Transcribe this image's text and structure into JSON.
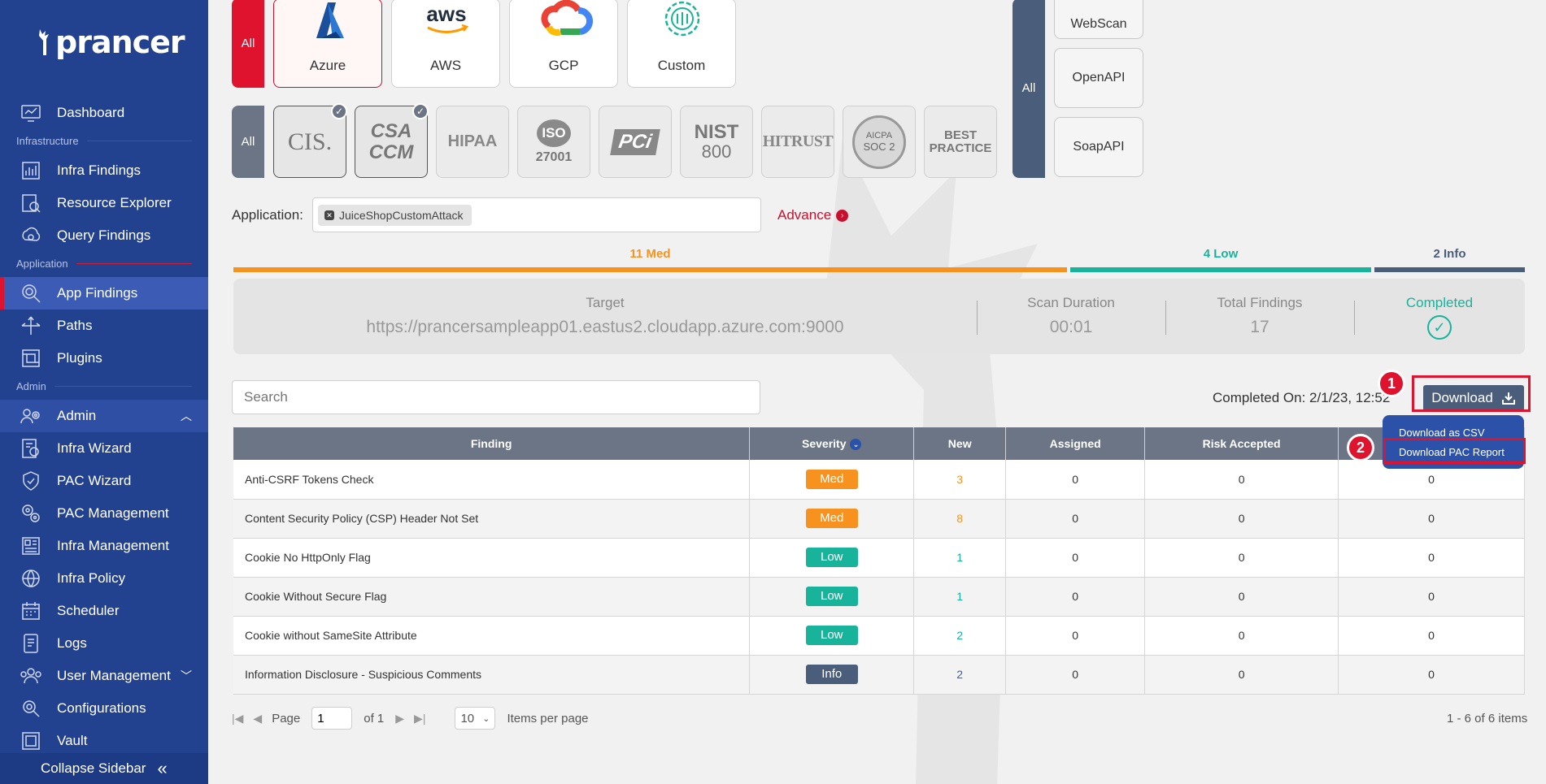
{
  "brand": {
    "name": "prancer"
  },
  "sidebar": {
    "sections": {
      "infrastructure": "Infrastructure",
      "application": "Application",
      "admin": "Admin"
    },
    "items": [
      {
        "label": "Dashboard",
        "icon": "dashboard-icon"
      },
      {
        "label": "Infra Findings",
        "icon": "infra-findings-icon"
      },
      {
        "label": "Resource Explorer",
        "icon": "resource-explorer-icon"
      },
      {
        "label": "Query Findings",
        "icon": "query-findings-icon"
      },
      {
        "label": "App Findings",
        "icon": "app-findings-icon",
        "active": true
      },
      {
        "label": "Paths",
        "icon": "paths-icon"
      },
      {
        "label": "Plugins",
        "icon": "plugins-icon"
      },
      {
        "label": "Admin",
        "icon": "admin-icon",
        "expanded": true
      },
      {
        "label": "Infra Wizard",
        "icon": "infra-wizard-icon"
      },
      {
        "label": "PAC Wizard",
        "icon": "pac-wizard-icon"
      },
      {
        "label": "PAC Management",
        "icon": "pac-management-icon"
      },
      {
        "label": "Infra Management",
        "icon": "infra-management-icon"
      },
      {
        "label": "Infra Policy",
        "icon": "infra-policy-icon"
      },
      {
        "label": "Scheduler",
        "icon": "scheduler-icon"
      },
      {
        "label": "Logs",
        "icon": "logs-icon"
      },
      {
        "label": "User Management",
        "icon": "user-management-icon"
      },
      {
        "label": "Configurations",
        "icon": "configurations-icon"
      },
      {
        "label": "Vault",
        "icon": "vault-icon"
      }
    ],
    "collapse_label": "Collapse Sidebar"
  },
  "filters": {
    "all_label": "All",
    "clouds": [
      "Azure",
      "AWS",
      "GCP",
      "Custom"
    ],
    "aws_logo_text": "aws",
    "compliance": [
      "CIS",
      "CSA CCM",
      "HIPAA",
      "ISO 27001",
      "PCI",
      "NIST 800",
      "HITRUST",
      "AICPA SOC 2",
      "BEST PRACTICE"
    ],
    "compliance_logo_text": {
      "cis": "CIS.",
      "csa": "CSA",
      "ccm": "CCM",
      "hipaa": "HIPAA",
      "iso": "ISO",
      "iso_num": "27001",
      "pci": "PCi",
      "nist": "NIST",
      "nist_num": "800",
      "hitrust": "HITRUST",
      "soc1": "AICPA",
      "soc2": "SOC 2",
      "bp1": "BEST",
      "bp2": "PRACTICE"
    },
    "compliance_checkmark": "✓",
    "scan_types": [
      "WebScan",
      "OpenAPI",
      "SoapAPI"
    ]
  },
  "application": {
    "label": "Application:",
    "chip": "JuiceShopCustomAttack",
    "chip_remove": "✕",
    "advance_label": "Advance",
    "advance_icon": "›"
  },
  "severity_summary": {
    "med": "11 Med",
    "low": "4 Low",
    "info": "2 Info",
    "colors": {
      "med": "#f7921e",
      "low": "#17b39a",
      "info": "#4a5d7a"
    }
  },
  "scan_summary": {
    "target_label": "Target",
    "target_value": "https://prancersampleapp01.eastus2.cloudapp.azure.com:9000",
    "duration_label": "Scan Duration",
    "duration_value": "00:01",
    "total_label": "Total Findings",
    "total_value": "17",
    "status_label": "Completed",
    "status_icon": "✓"
  },
  "toolbar": {
    "search_placeholder": "Search",
    "completed_on": "Completed On: 2/1/23, 12:52",
    "download_label": "Download",
    "download_menu": [
      "Download as CSV",
      "Download PAC Report"
    ],
    "step_1": "1",
    "step_2": "2"
  },
  "table": {
    "columns": [
      "Finding",
      "Severity",
      "New",
      "Assigned",
      "Risk Accepted",
      ""
    ],
    "sort_indicator": "⌄",
    "rows": [
      {
        "finding": "Anti-CSRF Tokens Check",
        "severity": "Med",
        "new": "3",
        "assigned": "0",
        "risk": "0",
        "last": "0"
      },
      {
        "finding": "Content Security Policy (CSP) Header Not Set",
        "severity": "Med",
        "new": "8",
        "assigned": "0",
        "risk": "0",
        "last": "0"
      },
      {
        "finding": "Cookie No HttpOnly Flag",
        "severity": "Low",
        "new": "1",
        "assigned": "0",
        "risk": "0",
        "last": "0"
      },
      {
        "finding": "Cookie Without Secure Flag",
        "severity": "Low",
        "new": "1",
        "assigned": "0",
        "risk": "0",
        "last": "0"
      },
      {
        "finding": "Cookie without SameSite Attribute",
        "severity": "Low",
        "new": "2",
        "assigned": "0",
        "risk": "0",
        "last": "0"
      },
      {
        "finding": "Information Disclosure - Suspicious Comments",
        "severity": "Info",
        "new": "2",
        "assigned": "0",
        "risk": "0",
        "last": "0"
      }
    ]
  },
  "pager": {
    "first_icon": "|◀",
    "prev_icon": "◀",
    "next_icon": "▶",
    "last_icon": "▶|",
    "page_label": "Page",
    "page_value": "1",
    "of_label": "of 1",
    "per_page": "10",
    "per_page_label": "Items per page",
    "items_count": "1 - 6 of 6 items"
  }
}
